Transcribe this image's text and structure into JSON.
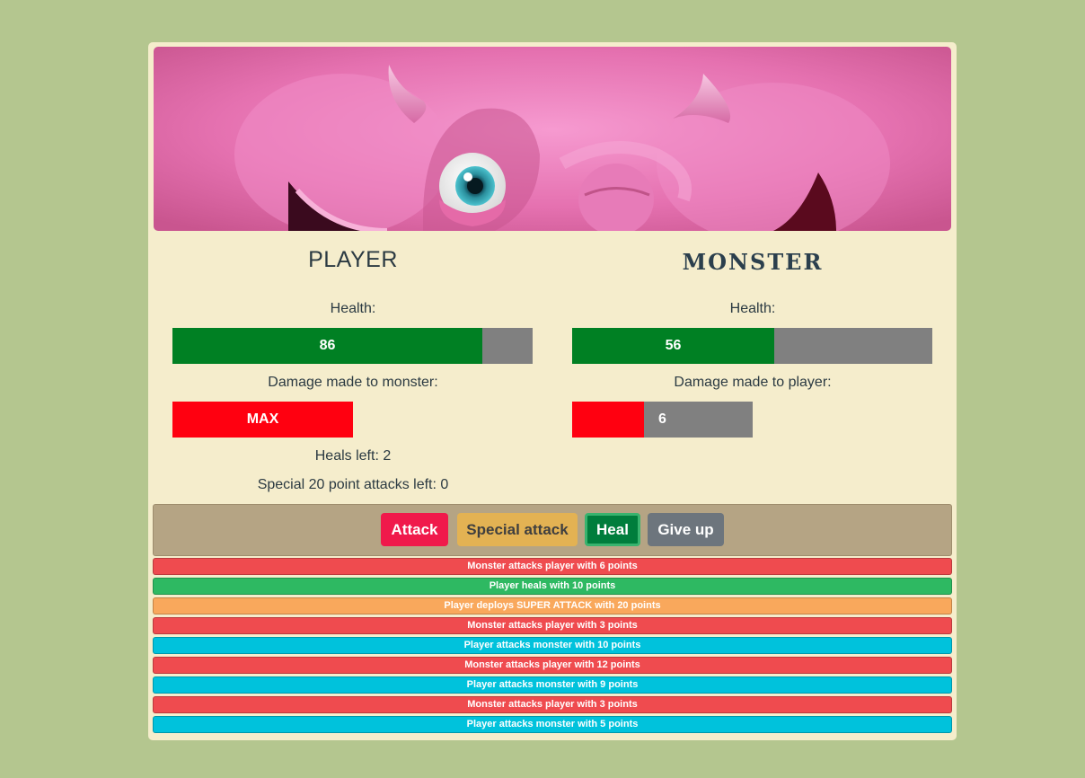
{
  "colors": {
    "page_bg": "#b4c68f",
    "panel_bg": "#f5edcc",
    "health_green": "#008023",
    "bar_grey": "#808080",
    "damage_red": "#ff0010",
    "controls_bg": "#b5a484",
    "log_monster": "#ef4b4f",
    "log_heal": "#2eb962",
    "log_special": "#f9a85c",
    "log_player": "#00c2dc"
  },
  "banner": {
    "image": "pink-monster-face"
  },
  "player": {
    "title": "PLAYER",
    "health_label": "Health:",
    "health_value": "86",
    "health_fraction": 0.86,
    "damage_label": "Damage made to monster:",
    "damage_value": "MAX",
    "damage_fraction": 1.0,
    "heals_left": "Heals left: 2",
    "special_left": "Special 20 point attacks left: 0"
  },
  "monster": {
    "title": "MONSTER",
    "health_label": "Health:",
    "health_value": "56",
    "health_fraction": 0.56,
    "damage_label": "Damage made to player:",
    "damage_value": "6",
    "damage_fraction": 0.4
  },
  "controls": {
    "attack": "Attack",
    "special": "Special attack",
    "heal": "Heal",
    "give_up": "Give up"
  },
  "log": [
    {
      "text": "Monster attacks player with 6 points",
      "kind": "monster"
    },
    {
      "text": "Player heals with 10 points",
      "kind": "heal"
    },
    {
      "text": "Player deploys SUPER ATTACK with 20 points",
      "kind": "special"
    },
    {
      "text": "Monster attacks player with 3 points",
      "kind": "monster"
    },
    {
      "text": "Player attacks monster with 10 points",
      "kind": "player"
    },
    {
      "text": "Monster attacks player with 12 points",
      "kind": "monster"
    },
    {
      "text": "Player attacks monster with 9 points",
      "kind": "player"
    },
    {
      "text": "Monster attacks player with 3 points",
      "kind": "monster"
    },
    {
      "text": "Player attacks monster with 5 points",
      "kind": "player"
    }
  ]
}
